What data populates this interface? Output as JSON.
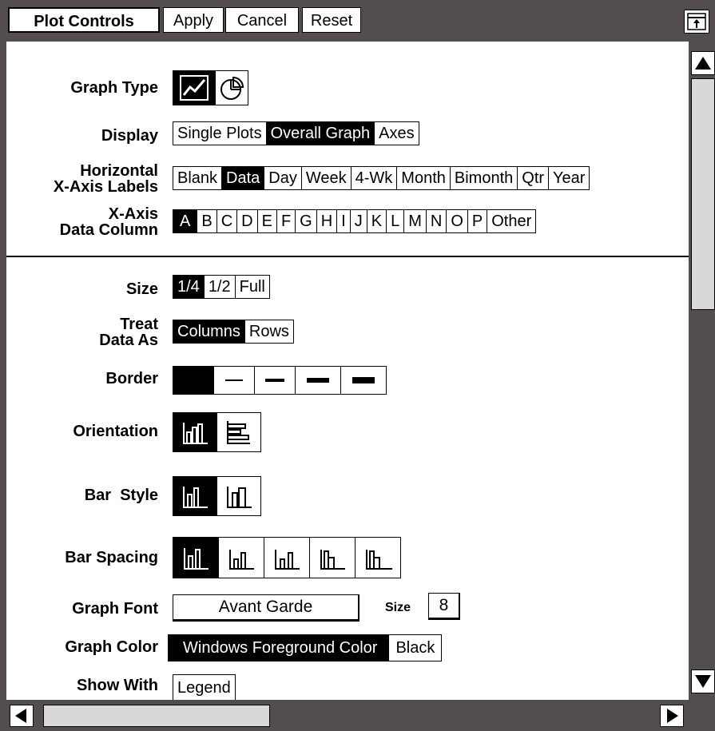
{
  "toolbar": {
    "title": "Plot Controls",
    "apply_label": "Apply",
    "cancel_label": "Cancel",
    "reset_label": "Reset"
  },
  "labels": {
    "graph_type": "Graph Type",
    "display": "Display",
    "horizontal_line1": "Horizontal",
    "horizontal_line2": "X-Axis Labels",
    "xaxis_line1": "X-Axis",
    "xaxis_line2": "Data Column",
    "size": "Size",
    "treat_line1": "Treat",
    "treat_line2": "Data As",
    "border": "Border",
    "orientation": "Orientation",
    "bar_style": "Bar  Style",
    "bar_spacing": "Bar Spacing",
    "graph_font": "Graph Font",
    "graph_color": "Graph Color",
    "show_with": "Show With"
  },
  "display_options": [
    "Single Plots",
    "Overall Graph",
    "Axes"
  ],
  "display_selected": 1,
  "xaxis_label_options": [
    "Blank",
    "Data",
    "Day",
    "Week",
    "4-Wk",
    "Month",
    "Bimonth",
    "Qtr",
    "Year"
  ],
  "xaxis_label_selected": 1,
  "data_column_options": [
    "A",
    "B",
    "C",
    "D",
    "E",
    "F",
    "G",
    "H",
    "I",
    "J",
    "K",
    "L",
    "M",
    "N",
    "O",
    "P",
    "Other"
  ],
  "data_column_selected": 0,
  "size_options": [
    "1/4",
    "1/2",
    "Full"
  ],
  "size_selected": 0,
  "treat_options": [
    "Columns",
    "Rows"
  ],
  "treat_selected": 0,
  "graph_font": {
    "value": "Avant Garde",
    "size_label": "Size",
    "size_value": "8"
  },
  "graph_color_options": [
    "Windows Foreground Color",
    "Black"
  ],
  "graph_color_selected": 0,
  "show_with_options": [
    "Legend"
  ],
  "icons": {
    "graph_type": [
      "line-graph-icon",
      "pie-chart-icon"
    ],
    "orientation": [
      "vertical-bars-icon",
      "horizontal-bars-icon"
    ],
    "bar_style": [
      "filled-bars-icon",
      "outline-bars-icon"
    ],
    "border": [
      "border-none-icon",
      "border-thin-icon",
      "border-medium-icon",
      "border-thick-icon",
      "border-heavy-icon"
    ]
  }
}
